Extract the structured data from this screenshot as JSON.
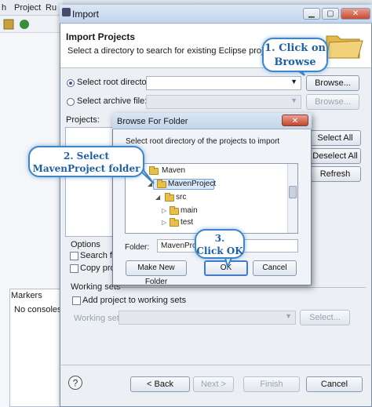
{
  "bg": {
    "menu_items": [
      "h",
      "Project",
      "Ru"
    ],
    "markers_tab": "Markers",
    "no_consoles": "No consoles"
  },
  "import": {
    "title": "Import",
    "header_title": "Import Projects",
    "header_desc": "Select a directory to search for existing Eclipse projects.",
    "root_dir_label": "Select root directory:",
    "archive_label": "Select archive file:",
    "browse_1": "Browse...",
    "browse_2": "Browse...",
    "projects_label": "Projects:",
    "select_all": "Select All",
    "deselect_all": "Deselect All",
    "refresh": "Refresh",
    "options_label": "Options",
    "search_for": "Search for",
    "copy_proj": "Copy proj",
    "working_sets_group": "Working sets",
    "add_to_ws": "Add project to working sets",
    "working_sets_label": "Working sets:",
    "select_ws": "Select...",
    "back": "< Back",
    "next": "Next >",
    "finish": "Finish",
    "cancel": "Cancel",
    "help_icon": "?"
  },
  "browse": {
    "title": "Browse For Folder",
    "message": "Select root directory of the projects to import",
    "tree": [
      "Maven",
      "MavenProject",
      "src",
      "main",
      "test"
    ],
    "folder_label": "Folder:",
    "folder_value": "MavenProject",
    "make_new_folder": "Make New Folder",
    "ok": "OK",
    "cancel": "Cancel"
  },
  "callouts": {
    "c1_line1": "1. Click on",
    "c1_line2": "Browse",
    "c2_line1": "2. Select",
    "c2_line2": "MavenProject folder",
    "c3_line1": "3.",
    "c3_line2": "Click OK"
  },
  "colors": {
    "accent": "#3d86c8",
    "callout_text": "#1e5fa6"
  }
}
